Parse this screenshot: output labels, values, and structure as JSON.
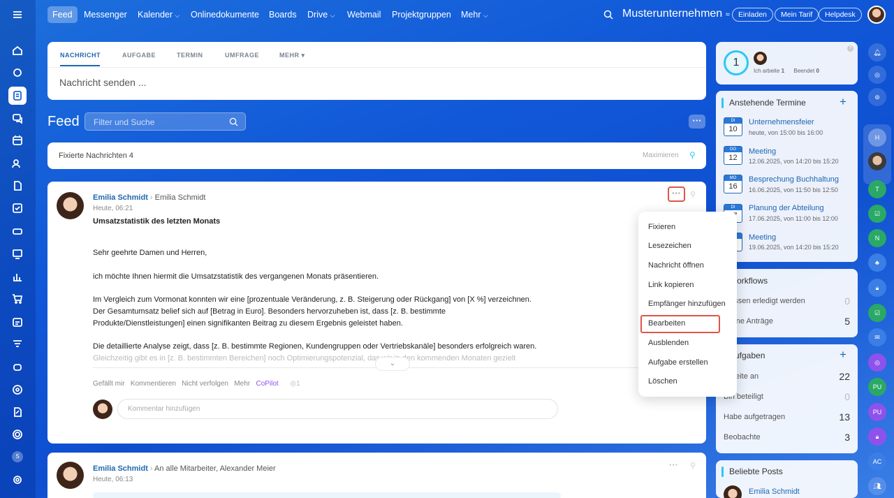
{
  "nav": {
    "items": [
      "Feed",
      "Messenger",
      "Kalender",
      "Onlinedokumente",
      "Boards",
      "Drive",
      "Webmail",
      "Projektgruppen",
      "Mehr"
    ],
    "company": "Musterunternehmen",
    "invite": "Einladen",
    "plan": "Mein Tarif",
    "helpdesk": "Helpdesk"
  },
  "composer": {
    "tabs": [
      "NACHRICHT",
      "AUFGABE",
      "TERMIN",
      "UMFRAGE",
      "MEHR"
    ],
    "placeholder": "Nachricht senden ..."
  },
  "feed": {
    "title": "Feed",
    "filter_placeholder": "Filter und Suche",
    "pinned_label": "Fixierte Nachrichten 4",
    "maximize": "Maximieren"
  },
  "post1": {
    "author": "Emilia Schmidt",
    "recipient": "Emilia Schmidt",
    "time": "Heute, 06:21",
    "subject": "Umsatzstatistik des letzten Monats",
    "p1": "Sehr geehrte Damen und Herren,",
    "p2": "ich möchte Ihnen hiermit die Umsatzstatistik des vergangenen Monats präsentieren.",
    "p3a": "Im Vergleich zum Vormonat konnten wir eine [prozentuale Veränderung, z. B. Steigerung oder Rückgang] von [X %] verzeichnen.",
    "p3b": "Der Gesamtumsatz belief sich auf [Betrag in Euro]. Besonders hervorzuheben ist, dass [z. B. bestimmte",
    "p3c": "Produkte/Dienstleistungen] einen signifikanten Beitrag zu diesem Ergebnis geleistet haben.",
    "p4a": "Die detaillierte Analyse zeigt, dass [z. B. bestimmte Regionen, Kundengruppen oder Vertriebskanäle] besonders erfolgreich waren.",
    "p4b": "Gleichzeitig gibt es in [z. B. bestimmten Bereichen] noch Optimierungspotenzial, das wir in den kommenden Monaten gezielt",
    "actions": [
      "Gefällt mir",
      "Kommentieren",
      "Nicht verfolgen",
      "Mehr",
      "CoPilot"
    ],
    "views": "1",
    "comment_placeholder": "Kommentar hinzufügen"
  },
  "post2": {
    "author": "Emilia Schmidt",
    "recipient": "An alle Mitarbeiter, Alexander Meier",
    "time": "Heute, 06:13"
  },
  "menu": [
    "Fixieren",
    "Lesezeichen",
    "Nachricht öffnen",
    "Link kopieren",
    "Empfänger hinzufügen",
    "Bearbeiten",
    "Ausblenden",
    "Aufgabe erstellen",
    "Löschen"
  ],
  "timeman": {
    "counter": "1",
    "working_label": "Ich arbeite",
    "working_count": "1",
    "done_label": "Beendet",
    "done_count": "0"
  },
  "events": {
    "title": "Anstehende Termine",
    "items": [
      {
        "day": "DI",
        "num": "10",
        "title": "Unternehmensfeier",
        "time": "heute, von 15:00 bis 16:00"
      },
      {
        "day": "DO",
        "num": "12",
        "title": "Meeting",
        "time": "12.06.2025, von 14:20 bis 15:20"
      },
      {
        "day": "MO",
        "num": "16",
        "title": "Besprechung Buchhaltung",
        "time": "16.06.2025, von 11:50 bis 12:50"
      },
      {
        "day": "DI",
        "num": "17",
        "title": "Planung der Abteilung",
        "time": "17.06.2025, von 11:00 bis 12:00"
      },
      {
        "day": "DO",
        "num": "19",
        "title": "Meeting",
        "time": "19.06.2025, von 14:20 bis 15:20"
      }
    ]
  },
  "workflows": {
    "title": "Workflows",
    "rows": [
      {
        "label": "Müssen erledigt werden",
        "count": "0"
      },
      {
        "label": "Meine Anträge",
        "count": "5"
      }
    ]
  },
  "tasks": {
    "title": "Aufgaben",
    "rows": [
      {
        "label": "Arbeite an",
        "count": "22"
      },
      {
        "label": "Bin beteiligt",
        "count": "0"
      },
      {
        "label": "Habe aufgetragen",
        "count": "13"
      },
      {
        "label": "Beobachte",
        "count": "3"
      }
    ]
  },
  "popular": {
    "title": "Beliebte Posts",
    "author": "Emilia Schmidt"
  },
  "rail": [
    "H",
    "T",
    "N",
    "PU",
    "PU",
    "AC"
  ],
  "user_initial": "S",
  "colors": {
    "accent": "#2067b0",
    "highlight": "#e0544a",
    "copilot": "#8e52ec"
  }
}
